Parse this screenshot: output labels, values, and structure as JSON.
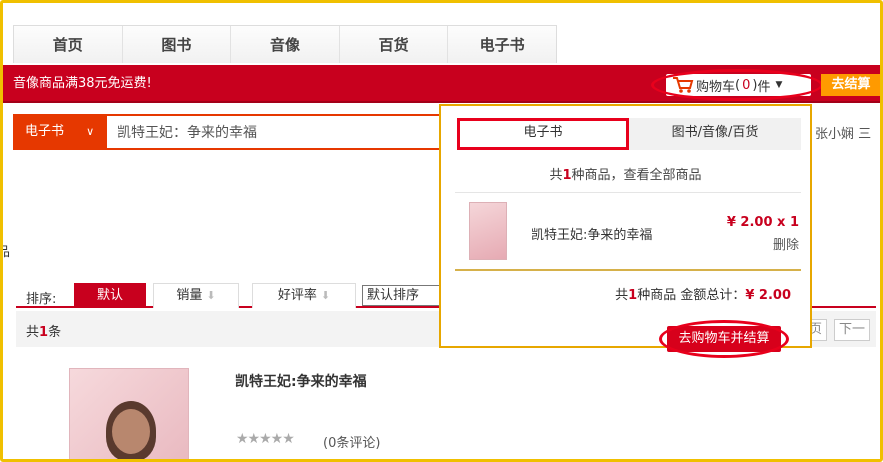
{
  "nav": {
    "items": [
      "首页",
      "图书",
      "音像",
      "百货",
      "电子书"
    ]
  },
  "banner": {
    "promo": "音像商品满38元免运费!"
  },
  "cart": {
    "label": "购物车",
    "count_open": "(",
    "count": "0",
    "count_close": ")",
    "unit": "件",
    "checkout": "去结算"
  },
  "search": {
    "category": "电子书",
    "value": "凯特王妃：争来的幸福"
  },
  "hot_right": "张小娴 三",
  "left_fragment": "品",
  "sort": {
    "label": "排序:",
    "default": "默认",
    "sales": "销量",
    "rating": "好评率",
    "select": "默认排序"
  },
  "results": {
    "prefix": "共",
    "count": "1",
    "suffix": "条",
    "pager_a": "页",
    "pager_b": "下一"
  },
  "product": {
    "title": "凯特王妃:争来的幸福",
    "stars": "★★★★★",
    "reviews": "(0条评论)"
  },
  "dropdown": {
    "tabs": [
      "电子书",
      "图书/音像/百货"
    ],
    "summary_prefix": "共",
    "summary_count": "1",
    "summary_suffix": "种商品，查看全部商品",
    "item": {
      "name": "凯特王妃:争来的幸福",
      "price": "¥ 2.00 x 1",
      "delete": "删除"
    },
    "total_prefix": "共",
    "total_count": "1",
    "total_mid": "种商品 金额总计：",
    "total_amount": "¥ 2.00",
    "checkout": "去购物车并结算"
  },
  "colors": {
    "brand_red": "#c8001e",
    "highlight_red": "#e8001c",
    "orange": "#ff9a00",
    "gold_border": "#e7a700"
  }
}
